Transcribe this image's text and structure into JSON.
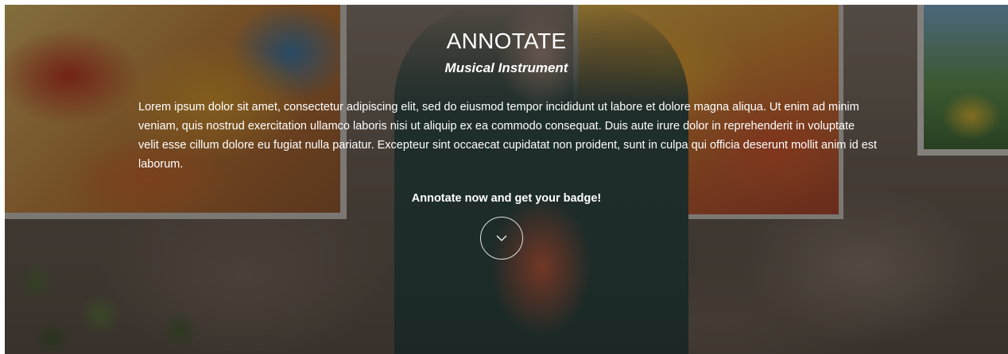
{
  "hero": {
    "title": "ANNOTATE",
    "subtitle": "Musical Instrument",
    "description": "Lorem ipsum dolor sit amet, consectetur adipiscing elit, sed do eiusmod tempor incididunt ut labore et dolore magna aliqua. Ut enim ad minim veniam, quis nostrud exercitation ullamco laboris nisi ut aliquip ex ea commodo consequat. Duis aute irure dolor in reprehenderit in voluptate velit esse cillum dolore eu fugiat nulla pariatur. Excepteur sint occaecat cupidatat non proident, sunt in culpa qui officia deserunt mollit anim id est laborum.",
    "cta_text": "Annotate now and get your badge!",
    "scroll_icon": "chevron-down-icon"
  },
  "colors": {
    "text": "#ffffff",
    "overlay": "rgba(20,16,14,0.48)",
    "page_background": "#ffffff"
  }
}
